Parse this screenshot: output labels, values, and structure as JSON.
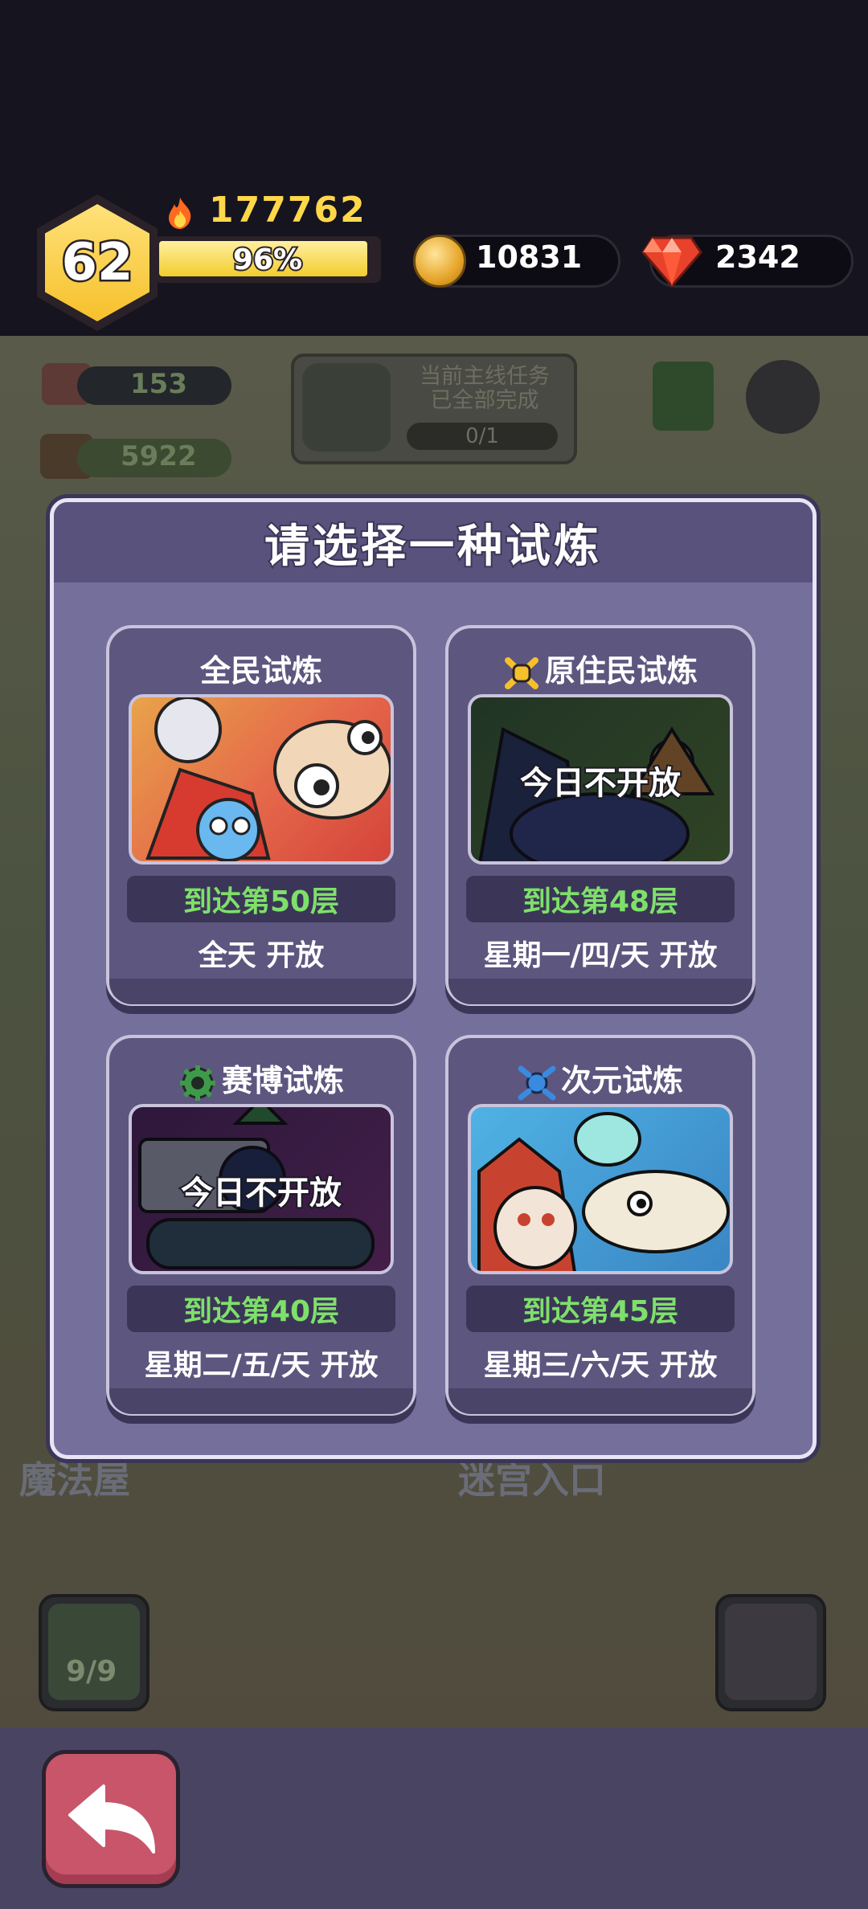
{
  "player": {
    "level": "62",
    "power": "177762",
    "xp_percent_label": "96%",
    "xp_fraction": 0.96
  },
  "resources": {
    "coins": "10831",
    "gems": "2342"
  },
  "scene": {
    "meat": "153",
    "wood": "5922",
    "quest_title_line1": "当前主线任务",
    "quest_title_line2": "已全部完成",
    "quest_progress": "0/1",
    "label_left": "魔法屋",
    "label_right": "迷宫入口",
    "slot_count": "9/9"
  },
  "modal": {
    "title": "请选择一种试炼",
    "cards": [
      {
        "title": "全民试炼",
        "icon": "none",
        "closed_text": "",
        "requirement": "到达第50层",
        "schedule": "全天  开放",
        "image": "brawl-characters"
      },
      {
        "title": "原住民试炼",
        "icon": "crossbones-icon",
        "closed_text": "今日不开放",
        "requirement": "到达第48层",
        "schedule": "星期一/四/天  开放",
        "image": "native-characters"
      },
      {
        "title": "赛博试炼",
        "icon": "gear-icon",
        "closed_text": "今日不开放",
        "requirement": "到达第40层",
        "schedule": "星期二/五/天  开放",
        "image": "cyber-characters"
      },
      {
        "title": "次元试炼",
        "icon": "dimension-icon",
        "closed_text": "",
        "requirement": "到达第45层",
        "schedule": "星期三/六/天  开放",
        "image": "dimension-characters"
      }
    ]
  },
  "colors": {
    "gold": "#ffd84a",
    "requirement_green": "#7ee06a",
    "modal_bg": "#756f9b",
    "back_button": "#c8556a"
  },
  "icons": {
    "back": "back-arrow-icon",
    "coin": "coin-icon",
    "gem": "gem-icon",
    "power": "flame-icon"
  }
}
